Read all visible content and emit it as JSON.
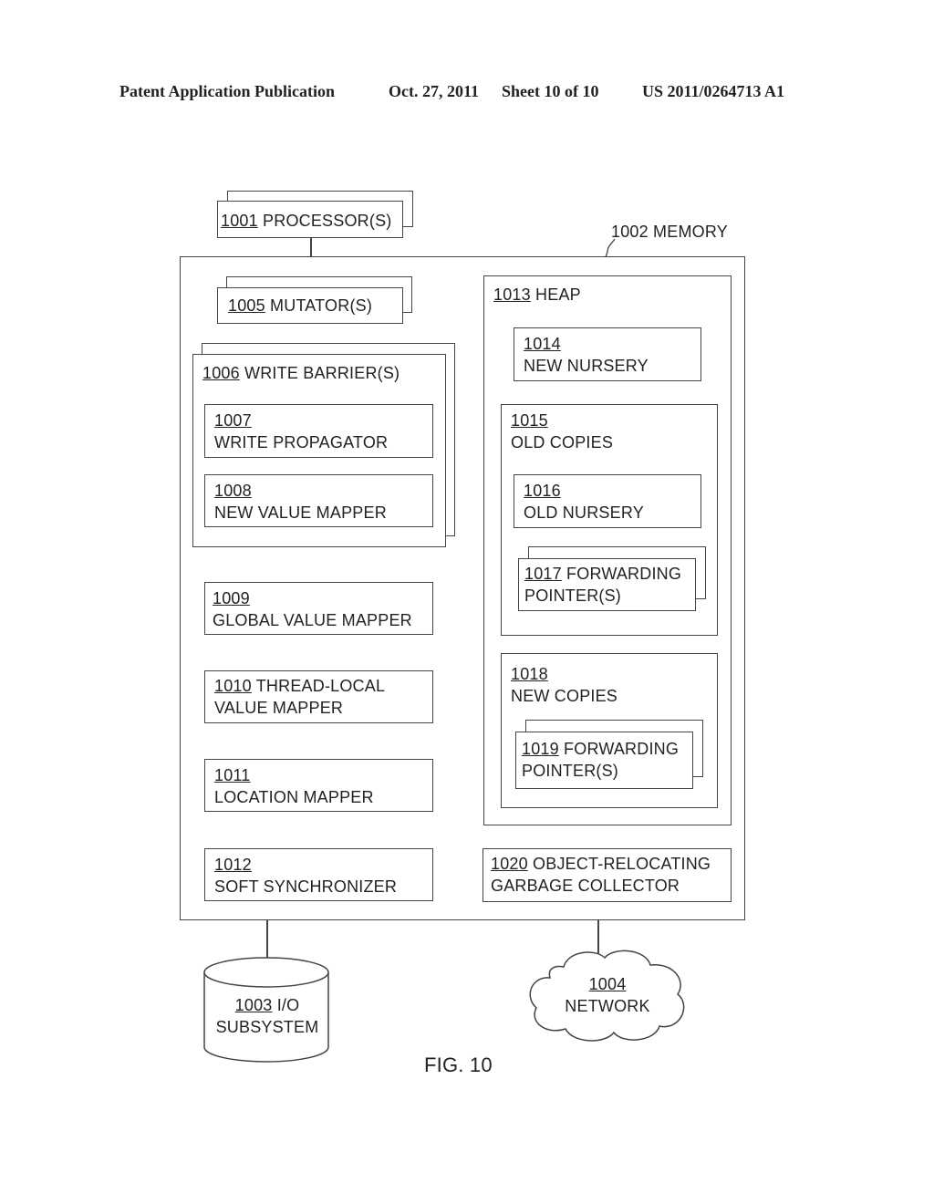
{
  "header": {
    "left": "Patent Application Publication",
    "date": "Oct. 27, 2011",
    "sheet": "Sheet 10 of 10",
    "patent_no": "US 2011/0264713 A1"
  },
  "figure_label": "FIG. 10",
  "nodes": {
    "processor": {
      "num": "1001",
      "text": "PROCESSOR(S)"
    },
    "memory": {
      "num": "1002",
      "text": "MEMORY"
    },
    "io": {
      "num": "1003",
      "text": "I/O",
      "text2": "SUBSYSTEM"
    },
    "network": {
      "num": "1004",
      "text": "NETWORK"
    },
    "mutator": {
      "num": "1005",
      "text": "MUTATOR(S)"
    },
    "write_barrier": {
      "num": "1006",
      "text": "WRITE BARRIER(S)"
    },
    "write_propagator": {
      "num": "1007",
      "text": "WRITE PROPAGATOR"
    },
    "new_value_mapper": {
      "num": "1008",
      "text": "NEW VALUE MAPPER"
    },
    "global_value_mapper": {
      "num": "1009",
      "text": "GLOBAL VALUE MAPPER"
    },
    "thread_local": {
      "num": "1010",
      "text": "THREAD-LOCAL",
      "text2": "VALUE MAPPER"
    },
    "location_mapper": {
      "num": "1011",
      "text": "LOCATION MAPPER"
    },
    "soft_sync": {
      "num": "1012",
      "text": "SOFT SYNCHRONIZER"
    },
    "heap": {
      "num": "1013",
      "text": "HEAP"
    },
    "new_nursery": {
      "num": "1014",
      "text": "NEW NURSERY"
    },
    "old_copies": {
      "num": "1015",
      "text": "OLD COPIES"
    },
    "old_nursery": {
      "num": "1016",
      "text": "OLD NURSERY"
    },
    "fwd_ptr_old": {
      "num": "1017",
      "text": "FORWARDING",
      "text2": "POINTER(S)"
    },
    "new_copies": {
      "num": "1018",
      "text": "NEW COPIES"
    },
    "fwd_ptr_new": {
      "num": "1019",
      "text": "FORWARDING",
      "text2": "POINTER(S)"
    },
    "gc": {
      "num": "1020",
      "text": "OBJECT-RELOCATING",
      "text2": "GARBAGE COLLECTOR"
    }
  }
}
